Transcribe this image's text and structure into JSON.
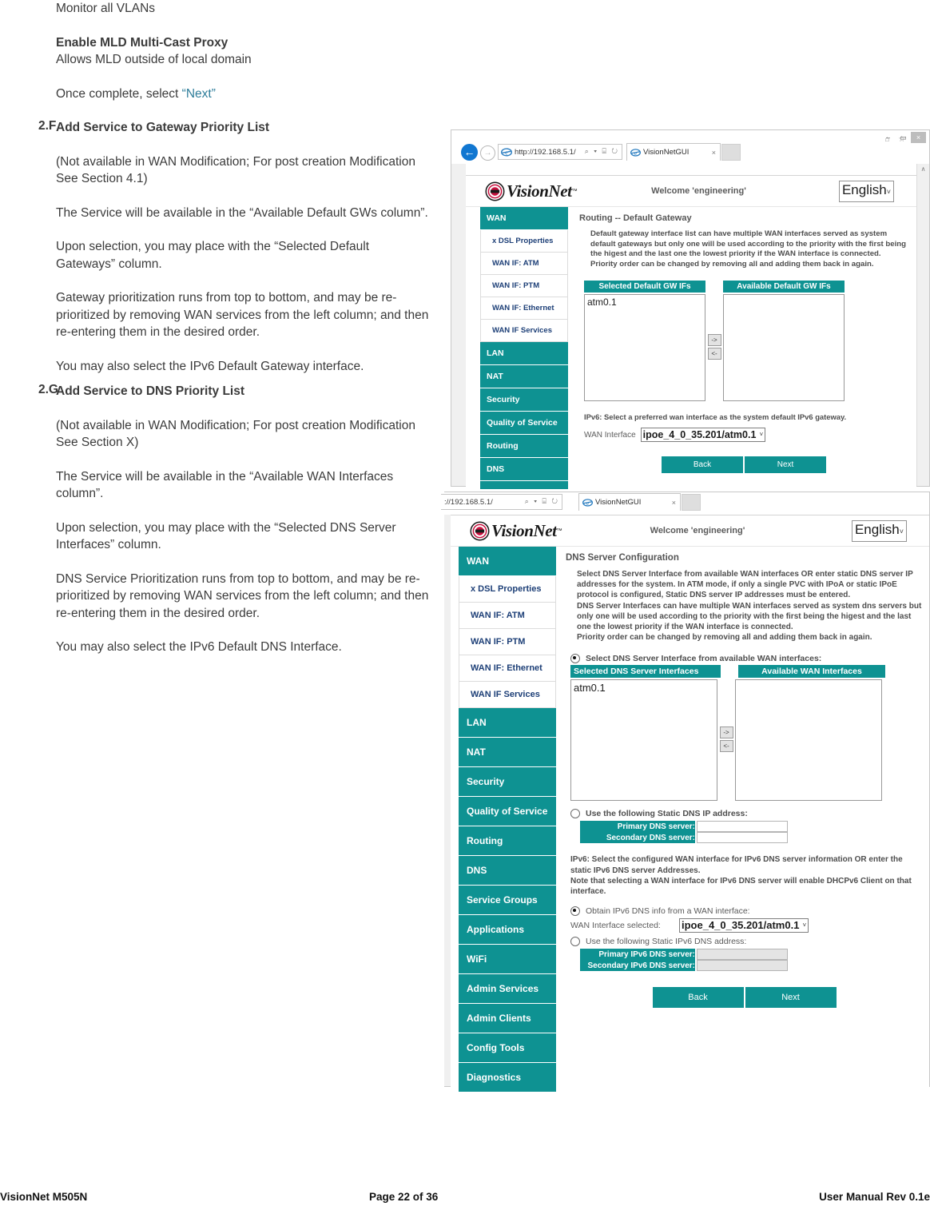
{
  "document": {
    "intro": {
      "monitor_line": "Monitor all VLANs",
      "mld_heading": "Enable MLD Multi-Cast Proxy",
      "mld_desc": "Allows MLD outside of local domain",
      "once_complete_prefix": "Once complete, select ",
      "once_complete_link": "“Next”"
    },
    "section_f": {
      "number": "2.F",
      "title": "Add Service to Gateway Priority List",
      "paragraphs": [
        "(Not available in WAN Modification;  For post creation Modification See Section 4.1)",
        "The Service will be available in the “Available Default GWs column”.",
        "Upon selection, you may place with the “Selected Default Gateways” column.",
        "Gateway prioritization runs from top to bottom, and may be re-prioritized by removing WAN services from the left column; and then re-entering them in the desired order.",
        "You may also select the IPv6 Default Gateway interface."
      ]
    },
    "section_g": {
      "number": "2.G",
      "title": "Add Service to DNS Priority List",
      "paragraphs": [
        "(Not available in WAN Modification;  For post creation Modification See Section X)",
        "The Service will be available in the “Available WAN Interfaces column”.",
        "Upon selection, you may place with the “Selected DNS Server Interfaces” column.",
        "DNS Service Prioritization runs from top to bottom, and may be re-prioritized by removing WAN services from the left column; and then re-entering them in the desired order.",
        "You may also select the IPv6 Default DNS Interface."
      ]
    }
  },
  "browser": {
    "url_gateway": "http://192.168.5.1/",
    "url_dns": "://192.168.5.1/",
    "tab_title": "VisionNetGUI",
    "tab_close": "×",
    "search_caret": "⌕ ▾ ⌸ ↻",
    "win_minimize": "–",
    "win_maximize": "▭",
    "win_close": "×",
    "chrome_icons": "⌂ ☆ ⚙",
    "nav_back": "←",
    "nav_forward": "→",
    "scroll_up": "∧"
  },
  "gui": {
    "brand_name": "VisionNet",
    "brand_tm": "™",
    "welcome": "Welcome 'engineering'",
    "language": "English",
    "caret": "˅",
    "sidebar": [
      {
        "label": "WAN",
        "type": "top"
      },
      {
        "label": "x DSL Properties",
        "type": "sub"
      },
      {
        "label": "WAN IF: ATM",
        "type": "sub"
      },
      {
        "label": "WAN IF: PTM",
        "type": "sub"
      },
      {
        "label": "WAN IF: Ethernet",
        "type": "sub"
      },
      {
        "label": "WAN IF Services",
        "type": "sub"
      },
      {
        "label": "LAN",
        "type": "item"
      },
      {
        "label": "NAT",
        "type": "item"
      },
      {
        "label": "Security",
        "type": "item"
      },
      {
        "label": "Quality of Service",
        "type": "item"
      },
      {
        "label": "Routing",
        "type": "item"
      },
      {
        "label": "DNS",
        "type": "item"
      },
      {
        "label": "Service Groups",
        "type": "item"
      },
      {
        "label": "Applications",
        "type": "item"
      },
      {
        "label": "WiFi",
        "type": "item"
      },
      {
        "label": "Admin Services",
        "type": "item"
      },
      {
        "label": "Admin Clients",
        "type": "item"
      },
      {
        "label": "Config Tools",
        "type": "item"
      },
      {
        "label": "Diagnostics",
        "type": "item"
      }
    ]
  },
  "gateway_page": {
    "title": "Routing -- Default Gateway",
    "desc_1": "Default gateway interface list can have multiple WAN interfaces served as system default gateways but only one will be used according to the priority with the first being the higest and the last one the lowest priority if the WAN interface is connected.",
    "desc_2": "Priority order can be changed by removing all and adding them back in again.",
    "col_selected": "Selected Default GW IFs",
    "col_available": "Available Default GW IFs",
    "selected_items": [
      "atm0.1"
    ],
    "available_items": [],
    "arrow_right": "->",
    "arrow_left": "<-",
    "ipv6_note": "IPv6: Select a preferred wan interface as the system default IPv6 gateway.",
    "wan_interface_label": "WAN Interface",
    "wan_interface_value": "ipoe_4_0_35.201/atm0.1",
    "back_label": "Back",
    "next_label": "Next"
  },
  "dns_page": {
    "title": "DNS Server Configuration",
    "desc_1": "Select DNS Server Interface from available WAN interfaces OR enter static DNS server IP addresses for the system. In ATM mode, if only a single PVC with IPoA or static IPoE protocol is configured, Static DNS server IP addresses must be entered.",
    "desc_2": "DNS Server Interfaces can have multiple WAN interfaces served as system dns servers but only one will be used according to the priority with the first being the higest and the last one the lowest priority if the WAN interface is connected.",
    "desc_3": "Priority order can be changed by removing all and adding them back in again.",
    "radio_select_iface": "Select DNS Server Interface from available WAN interfaces:",
    "col_selected": "Selected DNS Server Interfaces",
    "col_available": "Available WAN Interfaces",
    "selected_items": [
      "atm0.1"
    ],
    "available_items": [],
    "arrow_right": "->",
    "arrow_left": "<-",
    "radio_static_dns": "Use the following Static DNS IP address:",
    "primary_dns_label": "Primary DNS server:",
    "primary_dns_value": "",
    "secondary_dns_label": "Secondary DNS server:",
    "secondary_dns_value": "",
    "ipv6_note_1": "IPv6: Select the configured WAN interface for IPv6 DNS server information OR enter the static IPv6 DNS server Addresses.",
    "ipv6_note_2": "Note that selecting a WAN interface for IPv6 DNS server will enable DHCPv6 Client on that interface.",
    "radio_obtain_ipv6": "Obtain IPv6 DNS info from a WAN interface:",
    "wan_interface_label": "WAN Interface selected:",
    "wan_interface_value": "ipoe_4_0_35.201/atm0.1",
    "radio_static_ipv6": "Use the following Static IPv6 DNS address:",
    "primary_ipv6_label": "Primary IPv6 DNS server:",
    "primary_ipv6_value": "",
    "secondary_ipv6_label": "Secondary IPv6 DNS server:",
    "secondary_ipv6_value": "",
    "back_label": "Back",
    "next_label": "Next"
  },
  "footer": {
    "left": "VisionNet   M505N",
    "center": "Page 22 of 36",
    "right": "User Manual Rev 0.1e"
  },
  "colors": {
    "teal": "#0e9292",
    "link_blue": "#2e7d9a",
    "nav_sub_text": "#1d3f77",
    "ie_blue": "#1177d1"
  }
}
